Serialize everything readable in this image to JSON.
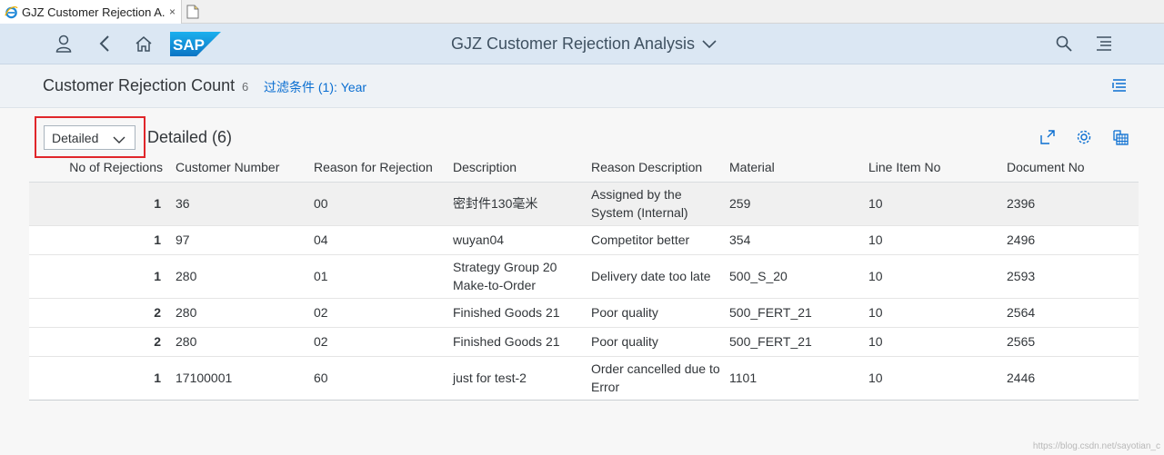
{
  "browser": {
    "tab_title": "GJZ Customer Rejection A...",
    "tab_close": "×"
  },
  "shell": {
    "logo_text": "SAP",
    "app_title": "GJZ Customer Rejection Analysis"
  },
  "subheader": {
    "title": "Customer Rejection Count",
    "count": "6",
    "filter": "过滤条件 (1):  Year"
  },
  "toolbar": {
    "variant": "Detailed",
    "table_title": "Detailed (6)"
  },
  "table": {
    "columns": [
      "No of Rejections",
      "Customer Number",
      "Reason for Rejection",
      "Description",
      "Reason Description",
      "Material",
      "Line Item No",
      "Document No"
    ],
    "rows": [
      [
        "1",
        "36",
        "00",
        "密封件130毫米",
        "Assigned by the System (Internal)",
        "259",
        "10",
        "2396"
      ],
      [
        "1",
        "97",
        "04",
        "wuyan04",
        "Competitor better",
        "354",
        "10",
        "2496"
      ],
      [
        "1",
        "280",
        "01",
        "Strategy Group 20 Make-to-Order",
        "Delivery date too late",
        "500_S_20",
        "10",
        "2593"
      ],
      [
        "2",
        "280",
        "02",
        "Finished Goods 21",
        "Poor quality",
        "500_FERT_21",
        "10",
        "2564"
      ],
      [
        "2",
        "280",
        "02",
        "Finished Goods 21",
        "Poor quality",
        "500_FERT_21",
        "10",
        "2565"
      ],
      [
        "1",
        "17100001",
        "60",
        "just for test-2",
        "Order cancelled due to Error",
        "1101",
        "10",
        "2446"
      ]
    ]
  },
  "watermark": "https://blog.csdn.net/sayotian_c",
  "colors": {
    "shell_bg": "#dbe7f3",
    "link": "#0a6ed1",
    "highlight_frame": "#e0262a",
    "selected_row": "#f0f0f0"
  }
}
